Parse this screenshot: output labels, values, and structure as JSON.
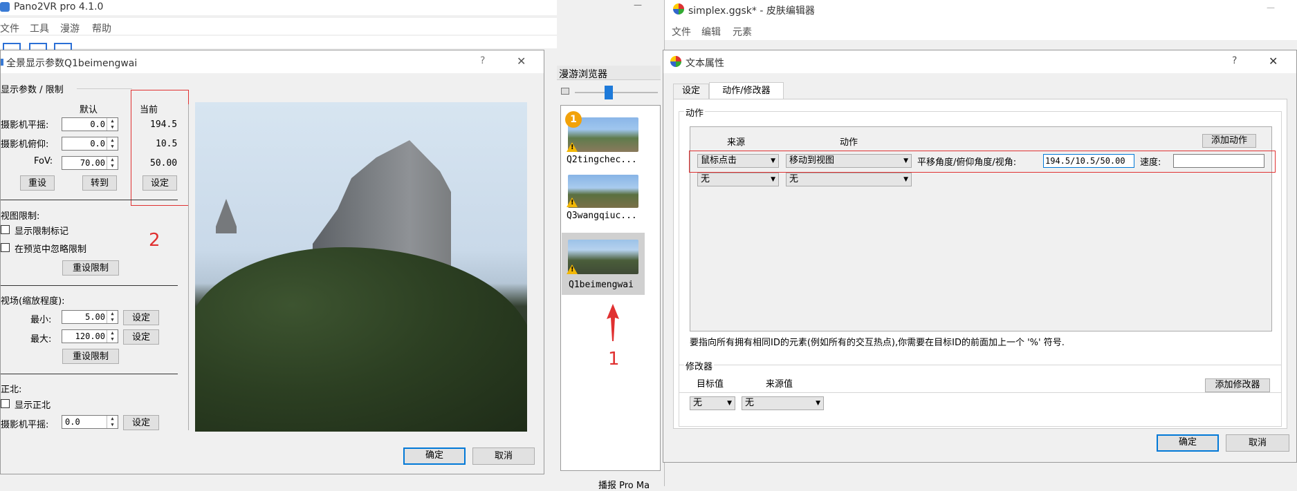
{
  "main_app": {
    "title": "Pano2VR pro 4.1.0",
    "menu": [
      "文件",
      "工具",
      "漫游",
      "帮助"
    ],
    "minimize_glyph": "—"
  },
  "skin_editor": {
    "title": "simplex.ggsk* - 皮肤编辑器",
    "menu": [
      "文件",
      "编辑",
      "元素"
    ],
    "minimize_glyph": "—"
  },
  "params_dialog": {
    "title": "全景显示参数Q1beimengwai",
    "help": "?",
    "close": "✕",
    "section_display": "显示参数 / 限制",
    "col_default": "默认",
    "col_current": "当前",
    "rows": [
      {
        "label": "摄影机平摇:",
        "default": "0.0",
        "current": "194.5"
      },
      {
        "label": "摄影机俯仰:",
        "default": "0.0",
        "current": "10.5"
      },
      {
        "label": "FoV:",
        "default": "70.00",
        "current": "50.00"
      }
    ],
    "reset_btn": "重设",
    "goto_btn": "转到",
    "set_btn": "设定",
    "view_limit_title": "视图限制:",
    "show_limit_marks": "显示限制标记",
    "ignore_limit_preview": "在预览中忽略限制",
    "reset_limit_btn": "重设限制",
    "fov_title": "视场(缩放程度):",
    "min_label": "最小:",
    "min_value": "5.00",
    "max_label": "最大:",
    "max_value": "120.00",
    "north_title": "正北:",
    "show_north": "显示正北",
    "north_pan_label": "摄影机平摇:",
    "north_pan_value": "0.0",
    "ok_btn": "确定",
    "cancel_btn": "取消",
    "annotation": "2"
  },
  "tour_browser": {
    "title": "漫游浏览器",
    "badge": "1",
    "items": [
      "Q2tingchec...",
      "Q3wangqiuc...",
      "Q1beimengwai"
    ],
    "annotation": "1",
    "bottom_text": "播报 Pro Ma"
  },
  "text_props": {
    "title": "文本属性",
    "help": "?",
    "close": "✕",
    "tabs": [
      "设定",
      "动作/修改器"
    ],
    "action_group": "动作",
    "col_source": "来源",
    "col_action": "动作",
    "add_action_btn": "添加动作",
    "rows": [
      {
        "source": "鼠标点击",
        "action": "移动到视图"
      },
      {
        "source": "无",
        "action": "无"
      }
    ],
    "param_label": "平移角度/俯仰角度/视角:",
    "param_value": "194.5/10.5/50.00",
    "speed_label": "速度:",
    "speed_value": "",
    "hint": "要指向所有拥有相同ID的元素(例如所有的交互热点),你需要在目标ID的前面加上一个 '%' 符号.",
    "modifier_group": "修改器",
    "col_target": "目标值",
    "col_source_value": "来源值",
    "add_modifier_btn": "添加修改器",
    "mod_target": "无",
    "mod_source": "无",
    "ok_btn": "确定",
    "cancel_btn": "取消"
  },
  "colors": {
    "annotation_red": "#e03030",
    "focus_blue": "#0078d7",
    "warning_yellow": "#f2b705"
  }
}
